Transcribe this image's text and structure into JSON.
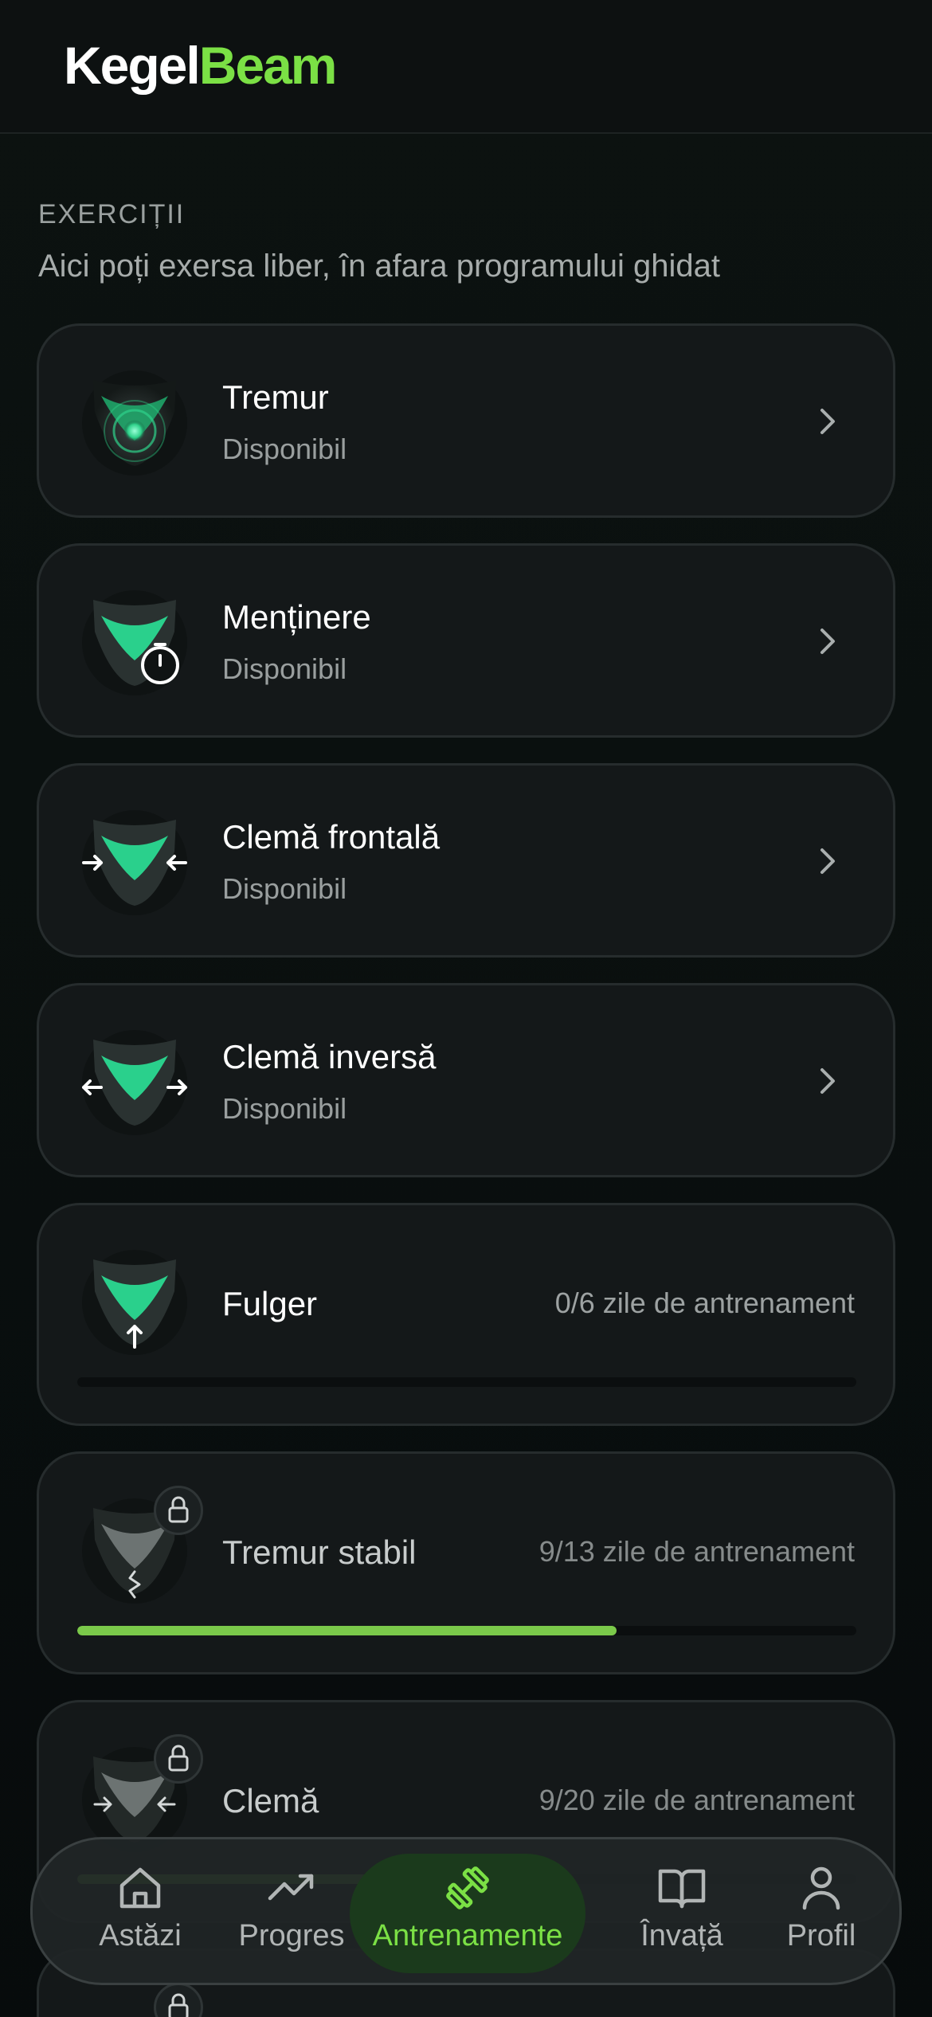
{
  "app": {
    "logo_part1": "Kegel",
    "logo_part2": "Beam"
  },
  "section": {
    "title": "EXERCIȚII",
    "subtitle": "Aici poți exersa liber, în afara programului ghidat"
  },
  "exercises": [
    {
      "title": "Tremur",
      "status": "Disponibil",
      "icon": "pelvis-tremor-icon"
    },
    {
      "title": "Menținere",
      "status": "Disponibil",
      "icon": "pelvis-hold-timer-icon"
    },
    {
      "title": "Clemă frontală",
      "status": "Disponibil",
      "icon": "pelvis-front-clamp-icon"
    },
    {
      "title": "Clemă inversă",
      "status": "Disponibil",
      "icon": "pelvis-reverse-clamp-icon"
    }
  ],
  "progress_items": [
    {
      "title": "Fulger",
      "progress_text": "0/6 zile de antrenament",
      "done": 0,
      "total": 6,
      "locked": false
    },
    {
      "title": "Tremur stabil",
      "progress_text": "9/13 zile de antrenament",
      "done": 9,
      "total": 13,
      "locked": true
    },
    {
      "title": "Clemă",
      "progress_text": "9/20 zile de antrenament",
      "done": 9,
      "total": 20,
      "locked": true
    }
  ],
  "nav": {
    "items": [
      {
        "label": "Astăzi",
        "icon": "home-icon",
        "active": false
      },
      {
        "label": "Progres",
        "icon": "trend-up-icon",
        "active": false
      },
      {
        "label": "Antrenamente",
        "icon": "dumbbell-icon",
        "active": true
      },
      {
        "label": "Învață",
        "icon": "book-icon",
        "active": false
      },
      {
        "label": "Profil",
        "icon": "user-icon",
        "active": false
      }
    ]
  },
  "colors": {
    "accent": "#7be045",
    "progress_fill": "#7bc94a",
    "card_bg": "#141819",
    "active_nav_bg": "#1b3a1c"
  }
}
